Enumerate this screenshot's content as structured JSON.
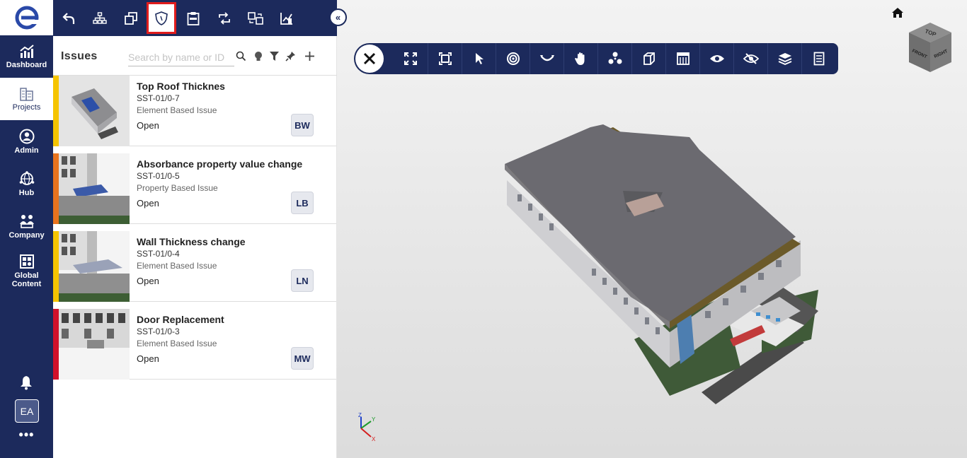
{
  "nav": {
    "items": [
      {
        "label": "Dashboard",
        "icon": "dashboard-chart-icon"
      },
      {
        "label": "Projects",
        "icon": "projects-building-icon"
      },
      {
        "label": "Admin",
        "icon": "admin-user-icon"
      },
      {
        "label": "Hub",
        "icon": "hub-globe-icon"
      },
      {
        "label": "Company",
        "icon": "company-people-icon"
      },
      {
        "label": "Global Content",
        "icon": "global-content-icon"
      }
    ],
    "avatar": "EA",
    "more": "•••"
  },
  "panel": {
    "title": "Issues",
    "search_placeholder": "Search by name or ID",
    "issues": [
      {
        "title": "Top Roof Thicknes",
        "id": "SST-01/0-7",
        "type": "Element Based Issue",
        "status": "Open",
        "assignee": "BW",
        "color": "#f5c400"
      },
      {
        "title": "Absorbance property value change",
        "id": "SST-01/0-5",
        "type": "Property Based Issue",
        "status": "Open",
        "assignee": "LB",
        "color": "#e8731e"
      },
      {
        "title": "Wall Thickness change",
        "id": "SST-01/0-4",
        "type": "Element Based Issue",
        "status": "Open",
        "assignee": "LN",
        "color": "#f5c400"
      },
      {
        "title": "Door Replacement",
        "id": "SST-01/0-3",
        "type": "Element Based Issue",
        "status": "Open",
        "assignee": "MW",
        "color": "#d0112b"
      }
    ]
  },
  "viewcube": {
    "top": "TOP",
    "front": "FRONT",
    "right": "RIGHT"
  },
  "axis": {
    "x": "X",
    "y": "Y",
    "z": "Z"
  },
  "colors": {
    "navy": "#1c2a5c",
    "highlight": "#e11c1c"
  }
}
